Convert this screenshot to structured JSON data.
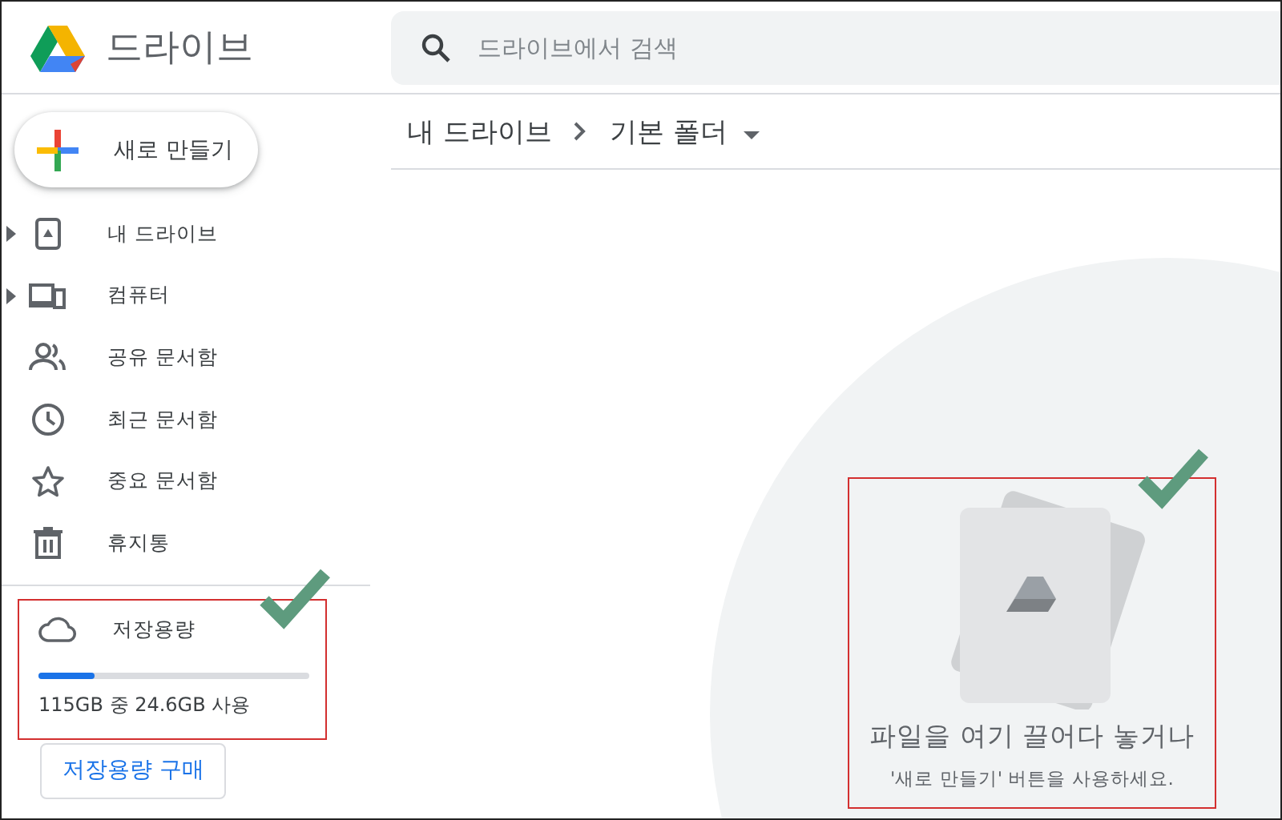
{
  "app": {
    "name": "드라이브"
  },
  "search": {
    "placeholder": "드라이브에서 검색"
  },
  "new_button": {
    "label": "새로 만들기"
  },
  "nav": [
    {
      "kind": "drive",
      "label": "내 드라이브",
      "expandable": true
    },
    {
      "kind": "computer",
      "label": "컴퓨터",
      "expandable": true
    },
    {
      "kind": "shared",
      "label": "공유 문서함",
      "expandable": false
    },
    {
      "kind": "recent",
      "label": "최근 문서함",
      "expandable": false
    },
    {
      "kind": "starred",
      "label": "중요 문서함",
      "expandable": false
    },
    {
      "kind": "trash",
      "label": "휴지통",
      "expandable": false
    }
  ],
  "storage": {
    "title": "저장용량",
    "level": 0.21,
    "usage": "115GB 중 24.6GB 사용",
    "buy_button": "저장용량 구매"
  },
  "breadcrumb": [
    {
      "label": "내 드라이브",
      "dropdown": false
    },
    {
      "label": "기본 폴더",
      "dropdown": true
    }
  ],
  "empty_state": {
    "title": "파일을 여기 끌어다 놓거나",
    "hint": "'새로 만들기' 버튼을 사용하세요."
  }
}
